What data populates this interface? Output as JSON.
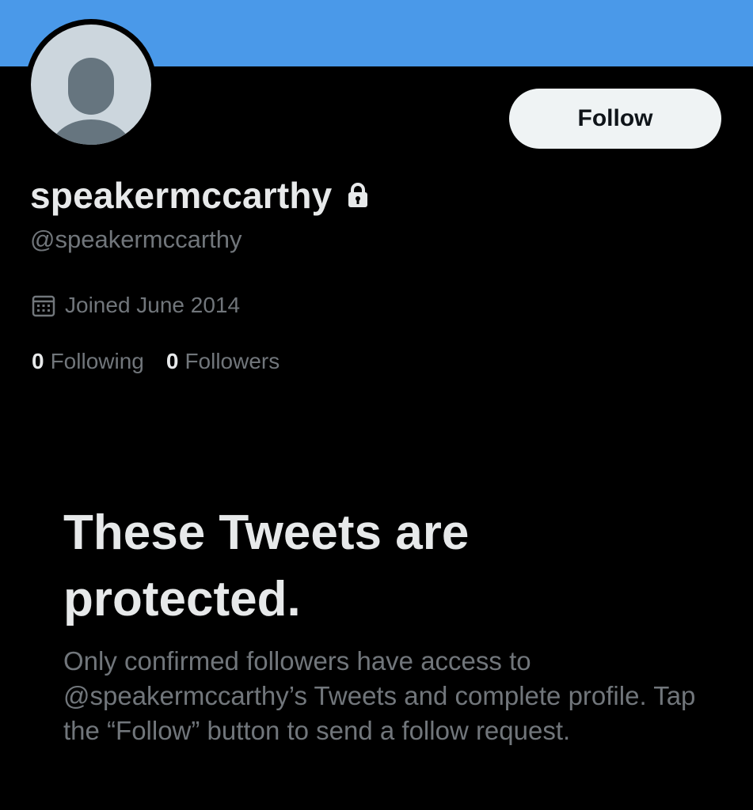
{
  "banner": {
    "color": "#4a99e9"
  },
  "avatar": {
    "icon": "default-avatar-icon"
  },
  "follow_button": {
    "label": "Follow"
  },
  "profile": {
    "display_name": "speakermccarthy",
    "locked": true,
    "lock_icon": "lock-icon",
    "handle": "@speakermccarthy",
    "joined_icon": "calendar-icon",
    "joined": "Joined June 2014",
    "following_count": "0",
    "following_label": "Following",
    "followers_count": "0",
    "followers_label": "Followers"
  },
  "protected": {
    "title": "These Tweets are protected.",
    "body": "Only confirmed followers have access to @speakermccarthy’s Tweets and complete profile. Tap the “Follow” button to send a follow request."
  }
}
